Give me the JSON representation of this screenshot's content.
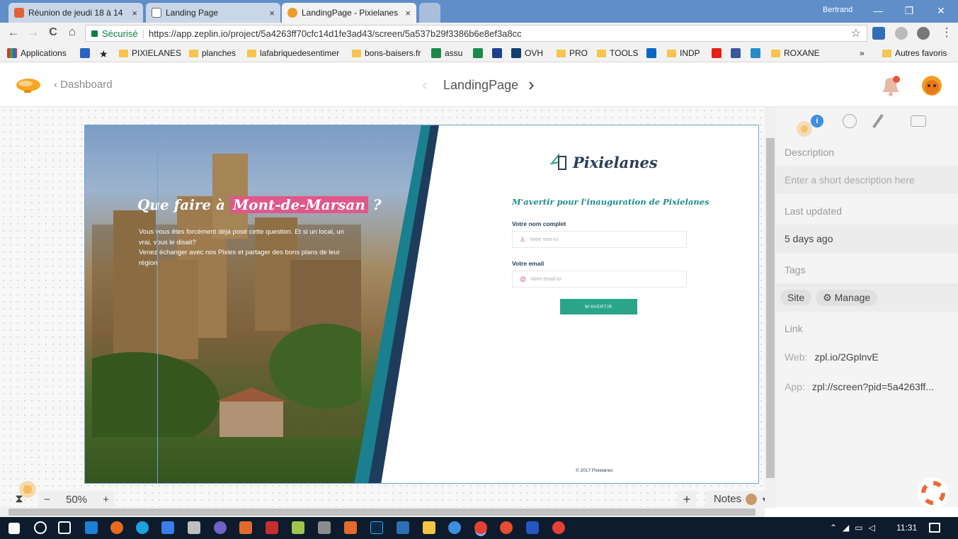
{
  "browser": {
    "tabs": [
      {
        "label": "Réunion de jeudi 18 à 14",
        "close": "×"
      },
      {
        "label": "Landing Page",
        "close": "×"
      },
      {
        "label": "LandingPage - Pixielanes",
        "close": "×"
      }
    ],
    "user": "Bertrand",
    "window_controls": {
      "minimize": "—",
      "restore": "❐",
      "close": "✕"
    },
    "nav": {
      "back": "←",
      "forward": "→",
      "reload": "C",
      "home": "⌂"
    },
    "secure_label": "Sécurisé",
    "url": "https://app.zeplin.io/project/5a4263ff70cfc14d1fe3ad43/screen/5a537b29f3386b6e8ef3a8cc",
    "star": "☆",
    "menu": "⋮"
  },
  "bookmarks": [
    {
      "label": "Applications",
      "icon": "apps-grid-icon"
    },
    {
      "label": "",
      "icon": "calendar-icon"
    },
    {
      "label": "",
      "icon": "star-icon"
    },
    {
      "label": "PIXIELANES",
      "icon": "folder-icon"
    },
    {
      "label": "planches",
      "icon": "folder-icon"
    },
    {
      "label": "lafabriquedesentimer",
      "icon": "folder-icon"
    },
    {
      "label": "bons-baisers.fr",
      "icon": "folder-icon"
    },
    {
      "label": "assu",
      "icon": "site-icon"
    },
    {
      "label": "",
      "icon": "site-icon"
    },
    {
      "label": "",
      "icon": "1and1-icon"
    },
    {
      "label": "OVH",
      "icon": "ovh-icon"
    },
    {
      "label": "PRO",
      "icon": "folder-icon"
    },
    {
      "label": "TOOLS",
      "icon": "folder-icon"
    },
    {
      "label": "",
      "icon": "linkedin-icon"
    },
    {
      "label": "INDP",
      "icon": "folder-icon"
    },
    {
      "label": "",
      "icon": "youtube-icon"
    },
    {
      "label": "",
      "icon": "facebook-icon"
    },
    {
      "label": "",
      "icon": "site-icon"
    },
    {
      "label": "ROXANE",
      "icon": "folder-icon"
    },
    {
      "label": "»",
      "icon": ""
    },
    {
      "label": "Autres favoris",
      "icon": "folder-icon"
    }
  ],
  "zeplin": {
    "dashboard_label": "Dashboard",
    "page_name": "LandingPage",
    "prev": "‹",
    "next": "›"
  },
  "artboard": {
    "hero_title_before": "Que faire à",
    "hero_title_highlight": "Mont-de-Marsan",
    "hero_title_after": "?",
    "hero_body_1": "Vous vous êtes forcément déjà posé cette question. Et si un local, un vrai, vous le disait?",
    "hero_body_2": "Venez échanger avec nos Pixies et partager des bons plans de leur région",
    "brand": "Pixielanes",
    "form_heading": "M'avertir pour l'inauguration de Pixielanes",
    "name_label": "Votre nom complet",
    "name_placeholder": "Votre nom ici",
    "email_label": "Votre email",
    "email_placeholder": "Votre email ici",
    "submit": "M'AVERTIR",
    "footer": "© 2017 Pixielanes"
  },
  "canvas_controls": {
    "zoom": "50%",
    "zoom_out": "−",
    "zoom_in": "+",
    "add": "+",
    "notes": "Notes"
  },
  "panel": {
    "description_label": "Description",
    "description_placeholder": "Enter a short description here",
    "last_updated_label": "Last updated",
    "last_updated_value": "5 days ago",
    "tags_label": "Tags",
    "tag_site": "Site",
    "tag_manage": "Manage",
    "link_label": "Link",
    "web_label": "Web:",
    "web_value": "zpl.io/2GplnvE",
    "app_label": "App:",
    "app_value": "zpl://screen?pid=5a4263ff..."
  },
  "taskbar": {
    "clock": "11:31"
  },
  "colors": {
    "accent_pink": "#e0578a",
    "accent_teal": "#2aa58a",
    "brand_navy": "#2b3f57",
    "chrome_blue": "#5f8ec9"
  }
}
